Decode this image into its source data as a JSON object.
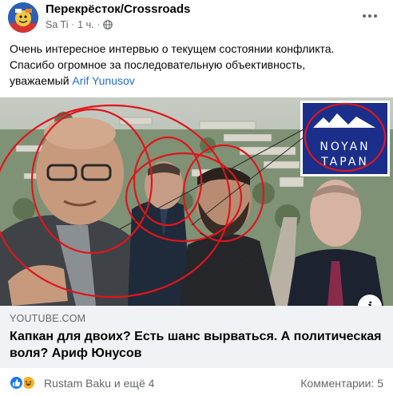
{
  "post": {
    "group_name": "Перекрёсток/Crossroads",
    "author": "Sa Ti",
    "time": "1 ч.",
    "text_lines": [
      "Очень интересное интервью о текущем состоянии конфликта.",
      "Спасибо огромное за последовательную объективность,",
      "уважаемый "
    ],
    "mention": "Arif Yunusov",
    "icons": {
      "privacy": "globe-icon",
      "menu": "more-dots-icon",
      "info": "info-icon"
    }
  },
  "link_preview": {
    "image_logo_line1": "NOYAN",
    "image_logo_line2": "TAPAN",
    "source": "YOUTUBE.COM",
    "title": "Капкан для двоих? Есть шанс вырваться. А политическая воля? Ариф Юнусов"
  },
  "reactions": {
    "icons": [
      "like-icon",
      "haha-icon"
    ],
    "reactors_text": "Rustam Baku и ещё 4",
    "comments_text": "Комментарии: 5"
  },
  "colors": {
    "accent": "#216fdb",
    "secondary_text": "#65676b",
    "footer_bg": "#f0f2f5",
    "circle_red": "#e0151b",
    "logo_blue": "#1b2f8a"
  }
}
